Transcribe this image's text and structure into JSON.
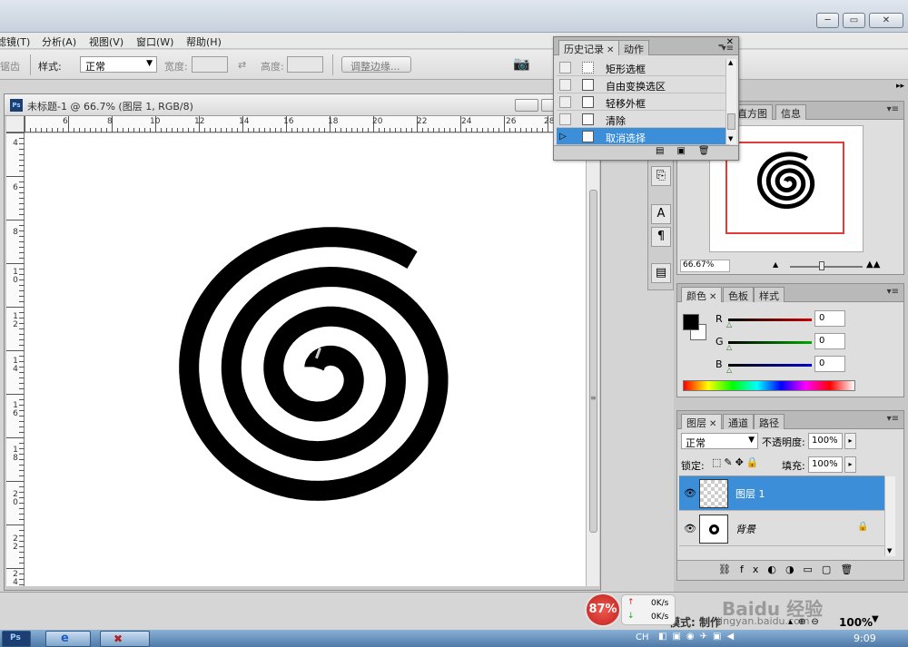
{
  "window": {
    "min": "─",
    "max": "▭",
    "close": "✕"
  },
  "menu": [
    "滤镜(T)",
    "分析(A)",
    "视图(V)",
    "窗口(W)",
    "帮助(H)"
  ],
  "options": {
    "antialias": "锯齿",
    "style_label": "样式:",
    "style_value": "正常",
    "width_label": "宽度:",
    "height_label": "高度:",
    "refine_button": "调整边缘..."
  },
  "document": {
    "title": "未标题-1 @ 66.7% (图层 1, RGB/8)",
    "ruler_h": [
      "6",
      "8",
      "10",
      "12",
      "14",
      "16",
      "18",
      "20",
      "22",
      "24",
      "26",
      "28"
    ],
    "ruler_v": [
      "4",
      "6",
      "8",
      "10",
      "12",
      "14",
      "16",
      "18",
      "20",
      "22",
      "24"
    ]
  },
  "history": {
    "tabs": [
      "历史记录",
      "动作"
    ],
    "items": [
      {
        "label": "矩形选框",
        "selected": false
      },
      {
        "label": "自由变换选区",
        "selected": false
      },
      {
        "label": "轻移外框",
        "selected": false
      },
      {
        "label": "清除",
        "selected": false
      },
      {
        "label": "取消选择",
        "selected": true
      }
    ]
  },
  "navigator": {
    "tabs": [
      "直方图",
      "信息"
    ],
    "zoom": "66.67%"
  },
  "color": {
    "tabs": [
      "颜色",
      "色板",
      "样式"
    ],
    "channels": [
      {
        "label": "R",
        "value": "0",
        "color": "#cc0000"
      },
      {
        "label": "G",
        "value": "0",
        "color": "#00aa00"
      },
      {
        "label": "B",
        "value": "0",
        "color": "#0000cc"
      }
    ]
  },
  "layers": {
    "tabs": [
      "图层",
      "通道",
      "路径"
    ],
    "blend_mode": "正常",
    "opacity_label": "不透明度:",
    "opacity_value": "100%",
    "lock_label": "锁定:",
    "fill_label": "填充:",
    "fill_value": "100%",
    "items": [
      {
        "name": "图层 1",
        "selected": true
      },
      {
        "name": "背景",
        "selected": false,
        "locked": true
      }
    ]
  },
  "status": {
    "zoom": "100%",
    "mode_label": "模式: 制作",
    "time": "9:09",
    "net_percent": "87%",
    "net_up": "0K/s",
    "net_down": "0K/s",
    "ime": "CH"
  },
  "watermark": "Baidu 经验",
  "watermark_url": "jingyan.baidu.com"
}
